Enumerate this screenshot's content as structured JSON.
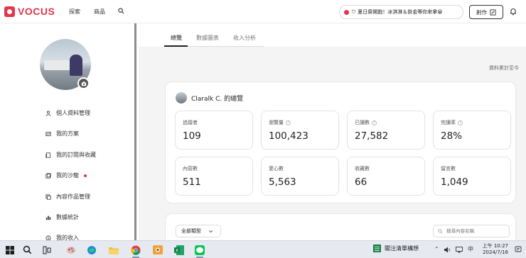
{
  "header": {
    "logo_text": "VOCUS",
    "nav": [
      "探索",
      "商品"
    ],
    "promo_text": "夏日祭開跑！冰淇淋＆掛金等你來拿",
    "promo_emoji": "😀",
    "create_label": "創作",
    "brand_color": "#e2364b"
  },
  "sidebar": {
    "items": [
      {
        "label": "個人資料管理",
        "icon": "person-icon"
      },
      {
        "label": "我的方案",
        "icon": "plan-icon"
      },
      {
        "label": "我的訂閱與收藏",
        "icon": "bookmark-icon"
      },
      {
        "label": "我的沙龍",
        "icon": "salon-icon",
        "badge": true
      },
      {
        "label": "內容作品管理",
        "icon": "content-icon"
      },
      {
        "label": "數據統計",
        "icon": "chart-icon"
      },
      {
        "label": "我的收入",
        "icon": "income-icon"
      }
    ]
  },
  "tabs": [
    {
      "label": "總覽",
      "active": true
    },
    {
      "label": "數據圖表",
      "active": false
    },
    {
      "label": "收入分析",
      "active": false
    }
  ],
  "main": {
    "update_note": "資料累計至今",
    "overview_title": "Claralk C. 的總覽",
    "stats": [
      {
        "label": "追蹤者",
        "value": "109",
        "info": false
      },
      {
        "label": "瀏覽量",
        "value": "100,423",
        "info": true
      },
      {
        "label": "已讀數",
        "value": "27,582",
        "info": true
      },
      {
        "label": "完讀率",
        "value": "28%",
        "info": true
      },
      {
        "label": "內容數",
        "value": "511",
        "info": false
      },
      {
        "label": "愛心數",
        "value": "5,563",
        "info": false
      },
      {
        "label": "收藏數",
        "value": "66",
        "info": false
      },
      {
        "label": "留言數",
        "value": "1,049",
        "info": false
      }
    ],
    "filter_label": "全部類型",
    "search_placeholder": "搜尋內容名稱"
  },
  "taskbar": {
    "active_app": "關注清單構想",
    "time": "上午 10:27",
    "date": "2024/7/16"
  }
}
